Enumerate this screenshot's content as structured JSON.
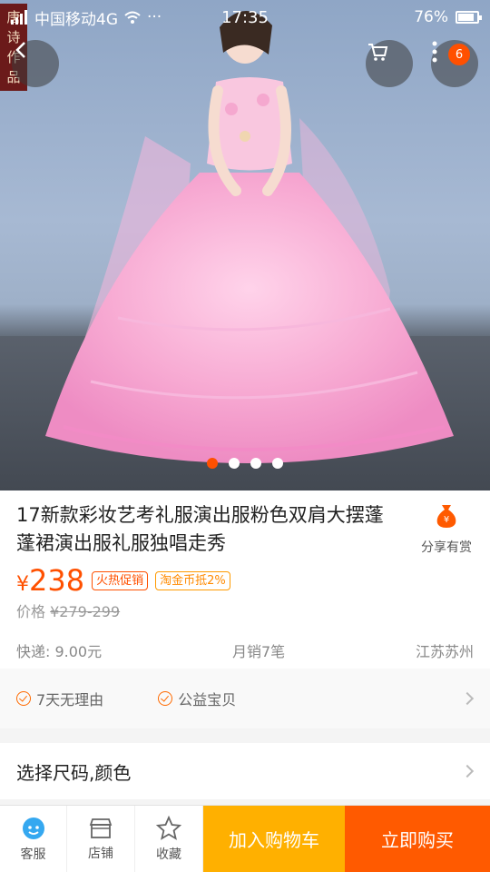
{
  "status_bar": {
    "carrier": "中国移动4G",
    "more": "···",
    "time": "17:35",
    "battery": "76%"
  },
  "hero": {
    "stamp_text": "唐 诗 丽 作 品",
    "cart_badge": "6",
    "active_slide": 0,
    "slide_count": 4
  },
  "product": {
    "title": "17新款彩妆艺考礼服演出服粉色双肩大摆蓬蓬裙演出服礼服独唱走秀",
    "share_label": "分享有赏",
    "price_symbol": "¥",
    "price": "238",
    "tag_hot": "火热促销",
    "tag_coin": "淘金币抵2%",
    "orig_label": "价格",
    "orig_price": "¥279-299",
    "shipping": "快递: 9.00元",
    "monthly_sales": "月销7笔",
    "location": "江苏苏州"
  },
  "services": {
    "item1": "7天无理由",
    "item2": "公益宝贝"
  },
  "sku": {
    "label": "选择尺码,颜色"
  },
  "bottom_bar": {
    "service_label": "客服",
    "shop_label": "店铺",
    "fav_label": "收藏",
    "add_cart_label": "加入购物车",
    "buy_label": "立即购买"
  },
  "colors": {
    "accent": "#ff5000",
    "cart_button": "#ffb000",
    "buy_button": "#ff5a00"
  },
  "icons": [
    "back-icon",
    "cart-icon",
    "more-icon",
    "money-bag-icon",
    "check-circle-icon",
    "chevron-right-icon",
    "customer-service-icon",
    "shop-icon",
    "star-icon"
  ]
}
